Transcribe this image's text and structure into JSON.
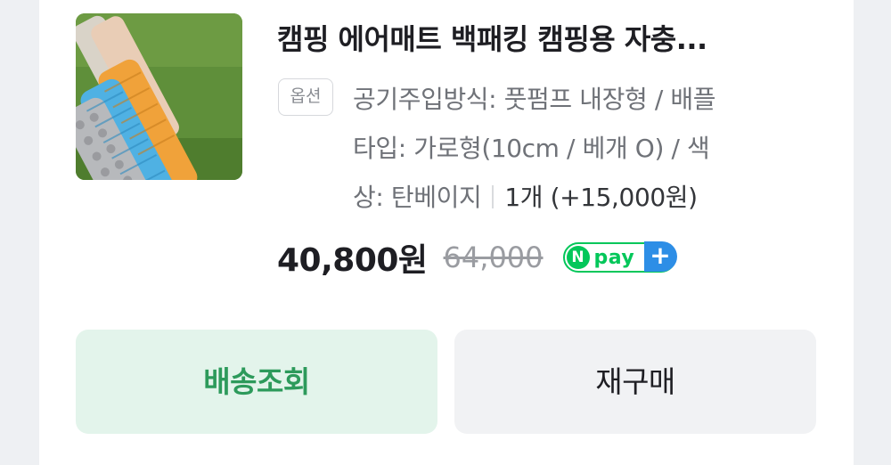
{
  "product": {
    "title": "캠핑 에어매트 백패킹 캠핑용 자충...",
    "option_badge": "옵션",
    "option_lines": [
      "공기주입방식: 풋펌프 내장형 / 배플",
      "타입: 가로형(10cm / 베개 O) / 색",
      "상: 탄베이지"
    ],
    "quantity": "1개 (+15,000원)",
    "price": "40,800원",
    "original_price": "64,000",
    "npay": {
      "n": "N",
      "label": "pay",
      "plus": "+"
    }
  },
  "buttons": {
    "shipping_label": "배송조회",
    "rebuy_label": "재구매"
  },
  "colors": {
    "npay_green": "#03c75a",
    "npay_blue": "#2d8ee6",
    "shipping_button_bg": "#e3f4eb",
    "shipping_button_text": "#2d9a5b"
  }
}
